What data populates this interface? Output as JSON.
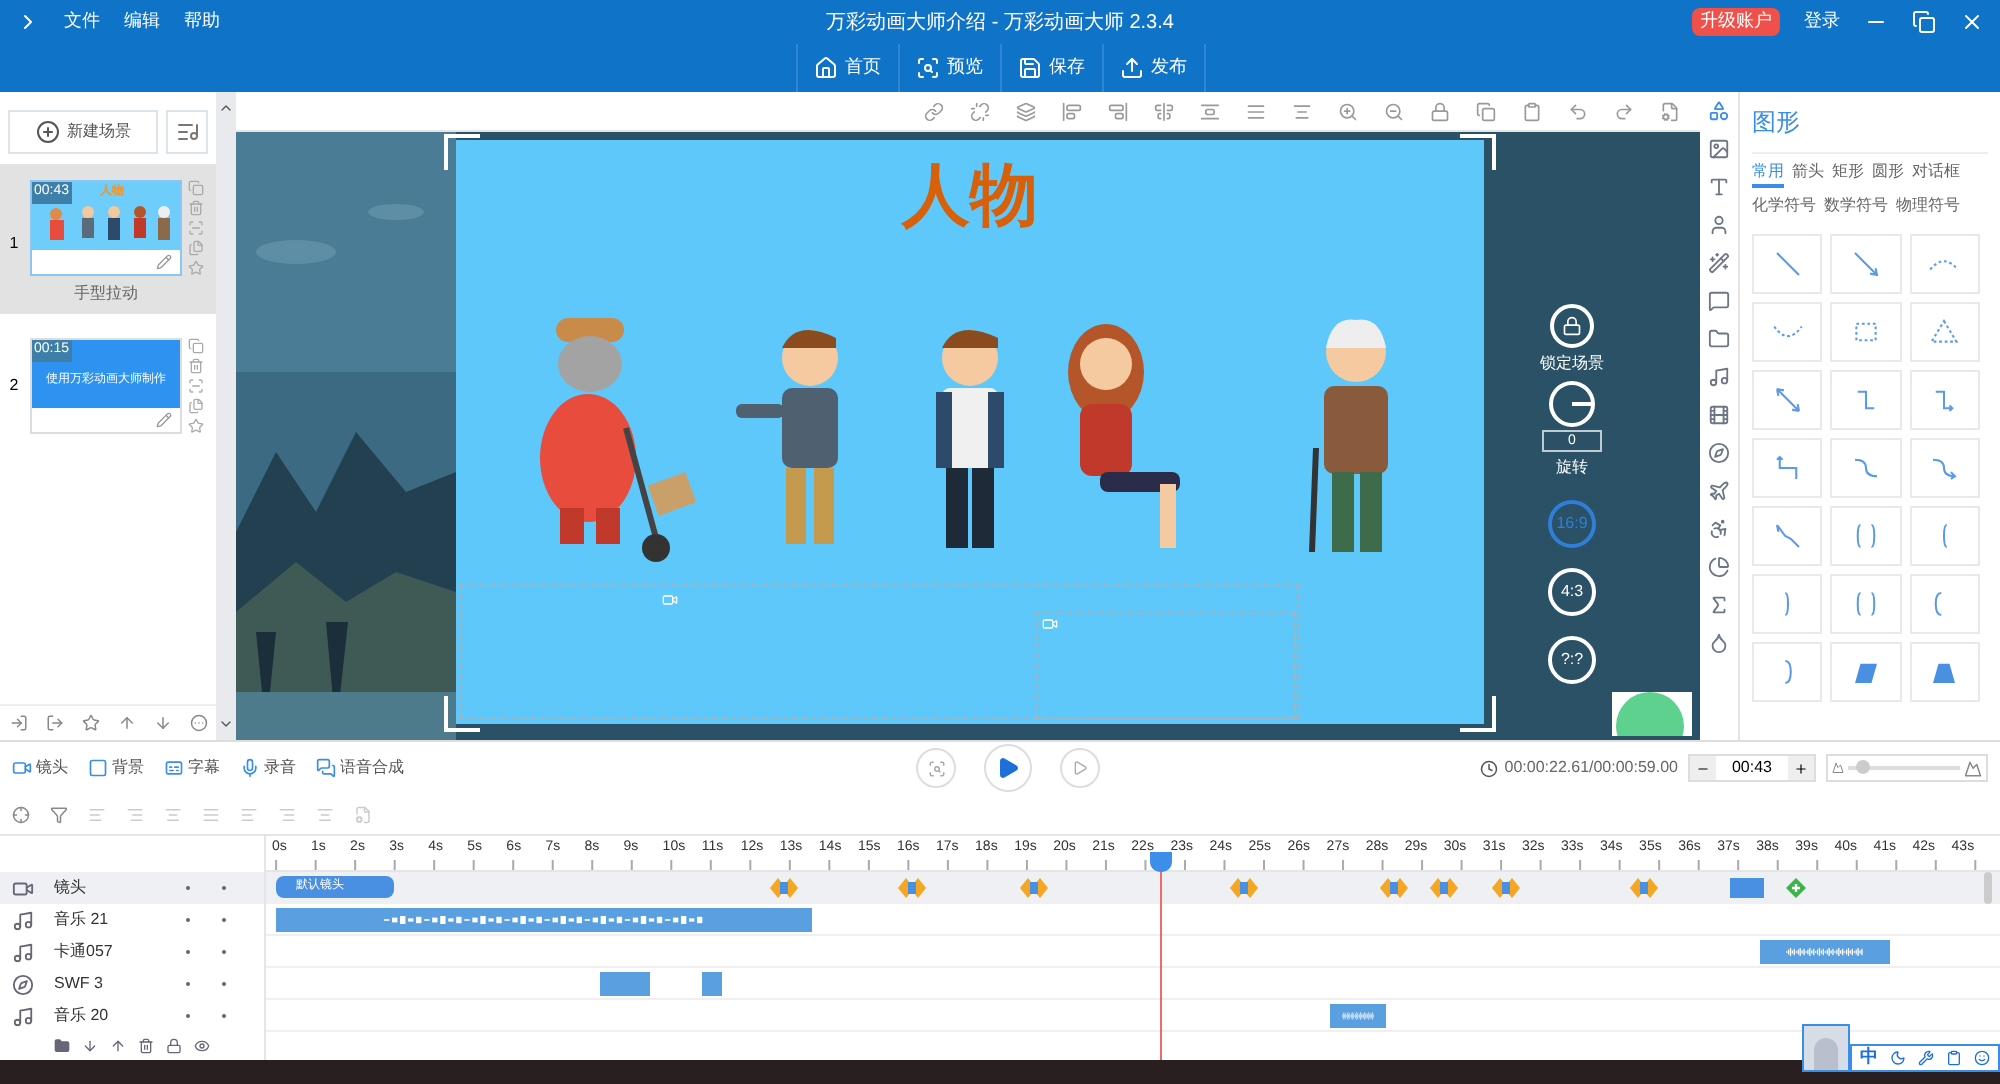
{
  "app_menu": [
    "文件",
    "编辑",
    "帮助"
  ],
  "window": {
    "title": "万彩动画大师介绍 - 万彩动画大师 2.3.4"
  },
  "upgrade_badge": "升级账户",
  "login": "登录",
  "main_toolbar": [
    "首页",
    "预览",
    "保存",
    "发布"
  ],
  "new_scene": "新建场景",
  "scenes": [
    {
      "number": "1",
      "duration": "00:43",
      "thumb_title": "人物",
      "name": "手型拉动",
      "selected": true
    },
    {
      "number": "2",
      "duration": "00:15",
      "thumb_text": "使用万彩动画大师制作",
      "selected": false
    }
  ],
  "canvas": {
    "title": "人物"
  },
  "canvas_controls": {
    "lock_label": "锁定场景",
    "rotation_value": "0",
    "rotation_label": "旋转",
    "ratios": [
      {
        "label": "16:9",
        "selected": true
      },
      {
        "label": "4:3",
        "selected": false
      },
      {
        "label": "?:?",
        "selected": false
      }
    ]
  },
  "shape_panel": {
    "title": "图形",
    "tabs": [
      {
        "label": "常用",
        "selected": true
      },
      {
        "label": "箭头",
        "selected": false
      },
      {
        "label": "矩形",
        "selected": false
      },
      {
        "label": "圆形",
        "selected": false
      },
      {
        "label": "对话框",
        "selected": false
      },
      {
        "label": "化学符号",
        "selected": false
      },
      {
        "label": "数学符号",
        "selected": false
      },
      {
        "label": "物理符号",
        "selected": false
      }
    ]
  },
  "timeline": {
    "tools": [
      "镜头",
      "背景",
      "字幕",
      "录音",
      "语音合成"
    ],
    "time": "00:00:22.61/00:00:59.00",
    "duration": "00:43",
    "zoom": {
      "level": 0.08
    },
    "playhead": {
      "level": 0.526
    },
    "ticks": [
      "0s",
      "1s",
      "2s",
      "3s",
      "4s",
      "5s",
      "6s",
      "7s",
      "8s",
      "9s",
      "10s",
      "11s",
      "12s",
      "13s",
      "14s",
      "15s",
      "16s",
      "17s",
      "18s",
      "19s",
      "20s",
      "21s",
      "22s",
      "23s",
      "24s",
      "25s",
      "26s",
      "27s",
      "28s",
      "29s",
      "30s",
      "31s",
      "32s",
      "33s",
      "34s",
      "35s",
      "36s",
      "37s",
      "38s",
      "39s",
      "40s",
      "41s",
      "42s",
      "43s"
    ],
    "tracks": [
      {
        "name": "镜头",
        "kind": "camera",
        "clip_label": "默认镜头"
      },
      {
        "name": "音乐 21",
        "kind": "music"
      },
      {
        "name": "卡通057",
        "kind": "music"
      },
      {
        "name": "SWF 3",
        "kind": "swf"
      },
      {
        "name": "音乐 20",
        "kind": "music"
      }
    ]
  },
  "ime_bar": {
    "mode": "中"
  }
}
